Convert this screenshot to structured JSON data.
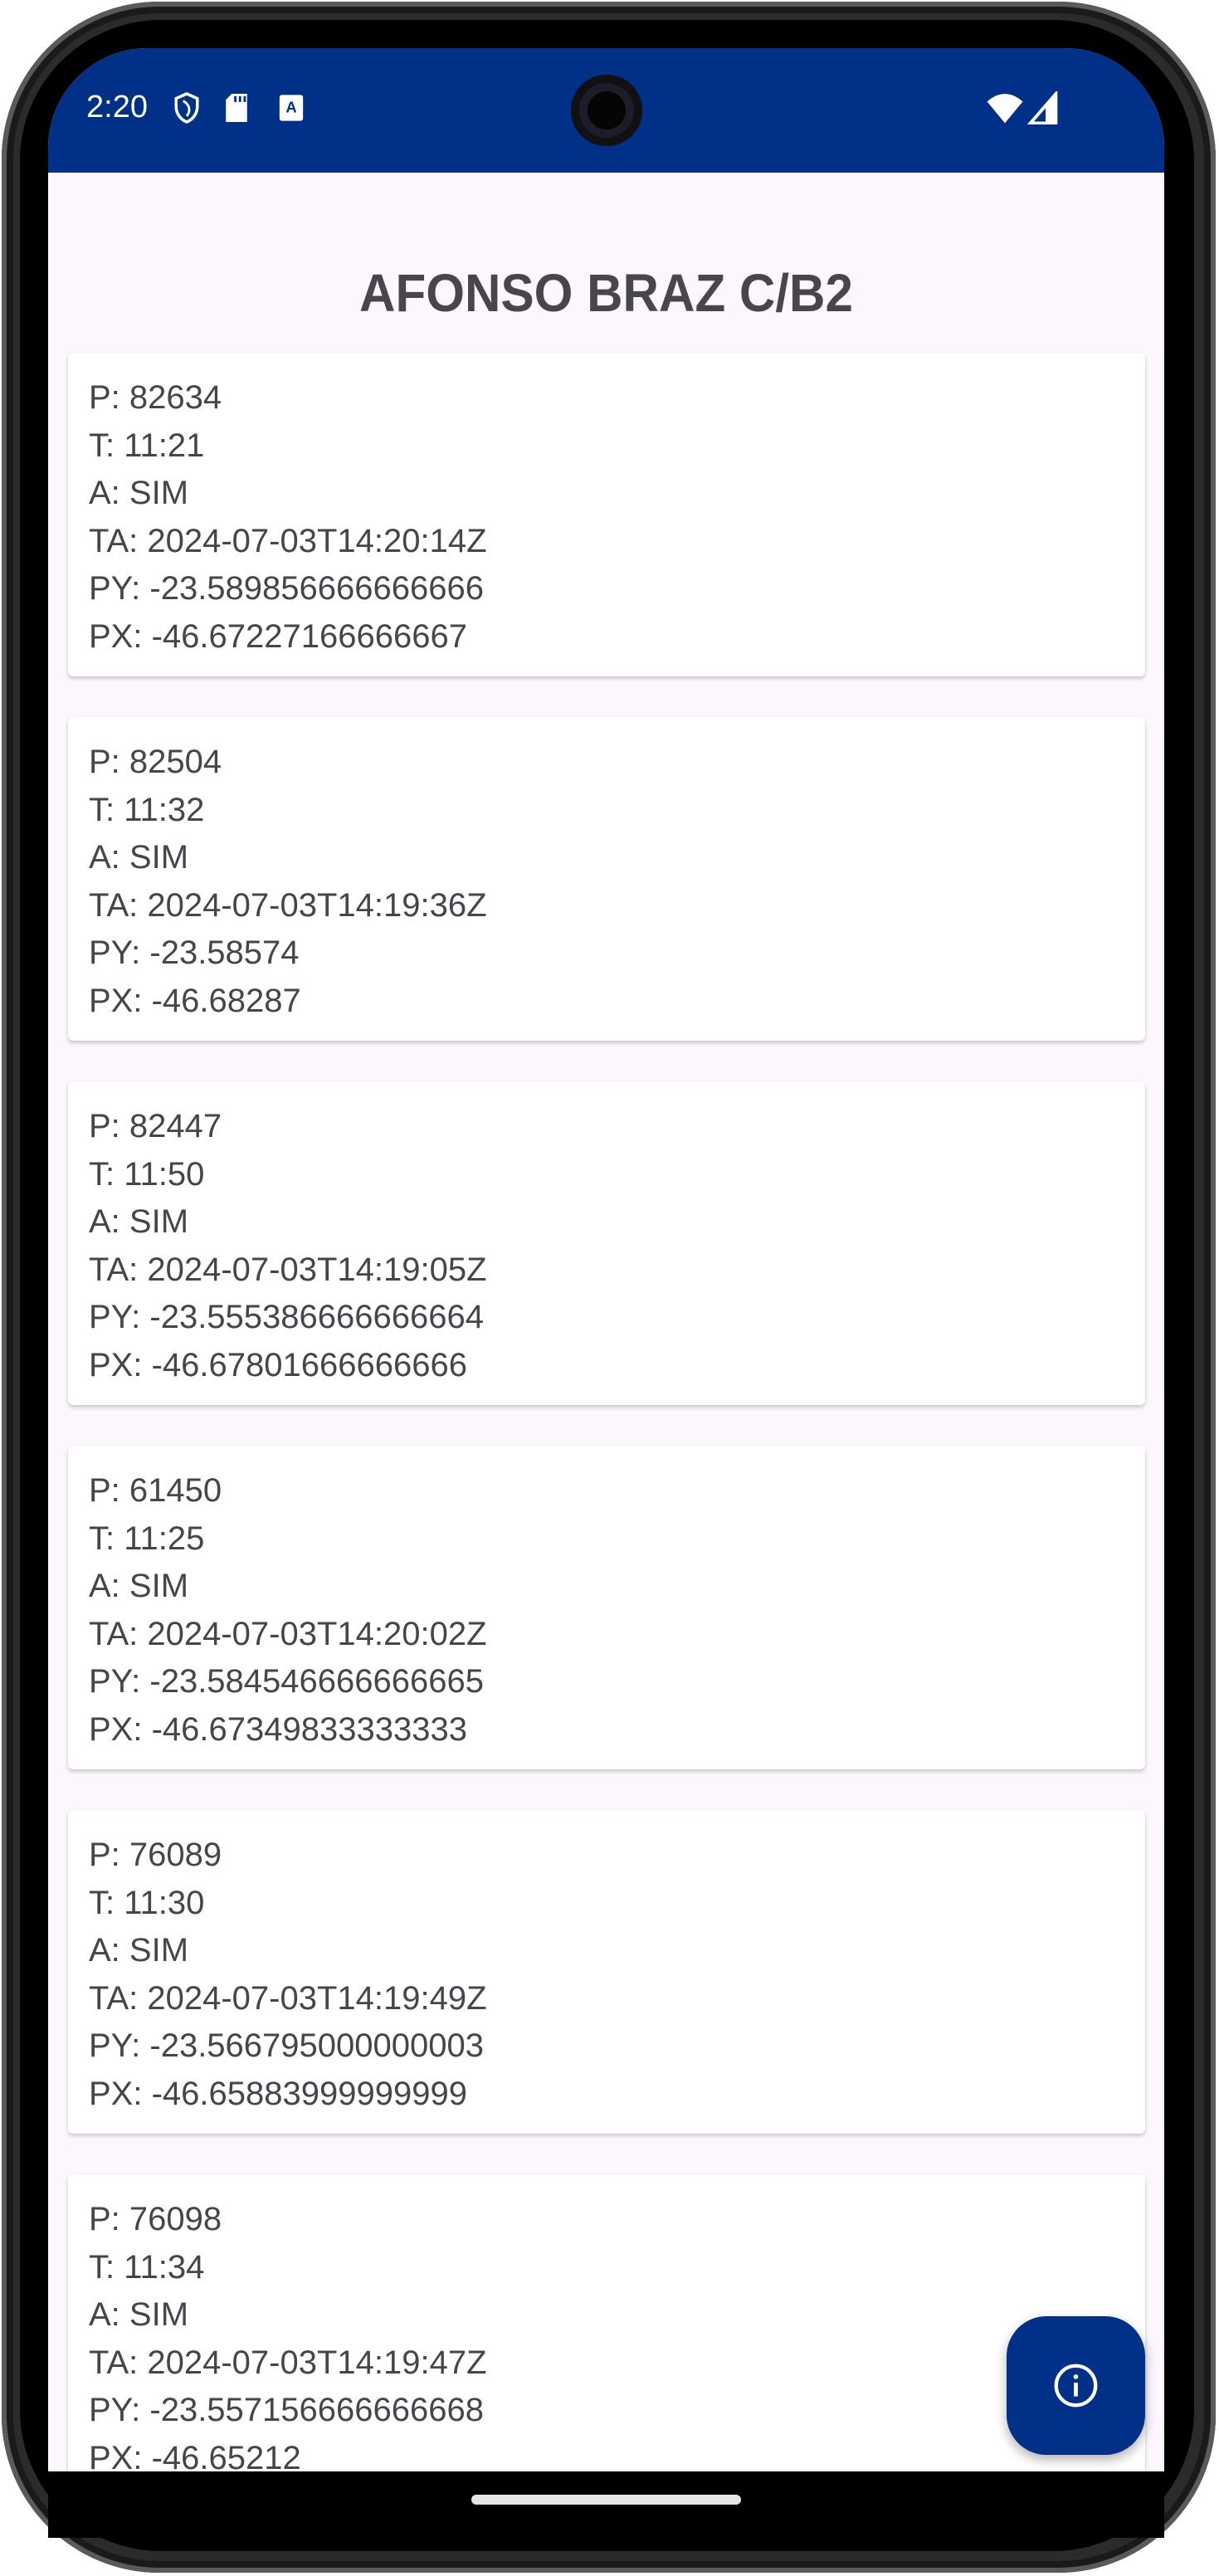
{
  "status_bar": {
    "time": "2:20",
    "left_icons": [
      "shield-icon",
      "sd-card-icon",
      "accessibility-a-icon"
    ],
    "right_icons": [
      "wifi-icon",
      "signal-icon"
    ],
    "color": "#003087"
  },
  "header": {
    "title": "AFONSO BRAZ C/B2"
  },
  "cards": [
    {
      "p": "P: 82634",
      "t": "T: 11:21",
      "a": "A: SIM",
      "ta": "TA: 2024-07-03T14:20:14Z",
      "py": "PY: -23.589856666666666",
      "px": "PX: -46.67227166666667"
    },
    {
      "p": "P: 82504",
      "t": "T: 11:32",
      "a": "A: SIM",
      "ta": "TA: 2024-07-03T14:19:36Z",
      "py": "PY: -23.58574",
      "px": "PX: -46.68287"
    },
    {
      "p": "P: 82447",
      "t": "T: 11:50",
      "a": "A: SIM",
      "ta": "TA: 2024-07-03T14:19:05Z",
      "py": "PY: -23.555386666666664",
      "px": "PX: -46.67801666666666"
    },
    {
      "p": "P: 61450",
      "t": "T: 11:25",
      "a": "A: SIM",
      "ta": "TA: 2024-07-03T14:20:02Z",
      "py": "PY: -23.584546666666665",
      "px": "PX: -46.67349833333333"
    },
    {
      "p": "P: 76089",
      "t": "T: 11:30",
      "a": "A: SIM",
      "ta": "TA: 2024-07-03T14:19:49Z",
      "py": "PY: -23.566795000000003",
      "px": "PX: -46.65883999999999"
    },
    {
      "p": "P: 76098",
      "t": "T: 11:34",
      "a": "A: SIM",
      "ta": "TA: 2024-07-03T14:19:47Z",
      "py": "PY: -23.557156666666668",
      "px": "PX: -46.65212"
    }
  ],
  "fab": {
    "icon": "info-icon",
    "color": "#003087"
  }
}
